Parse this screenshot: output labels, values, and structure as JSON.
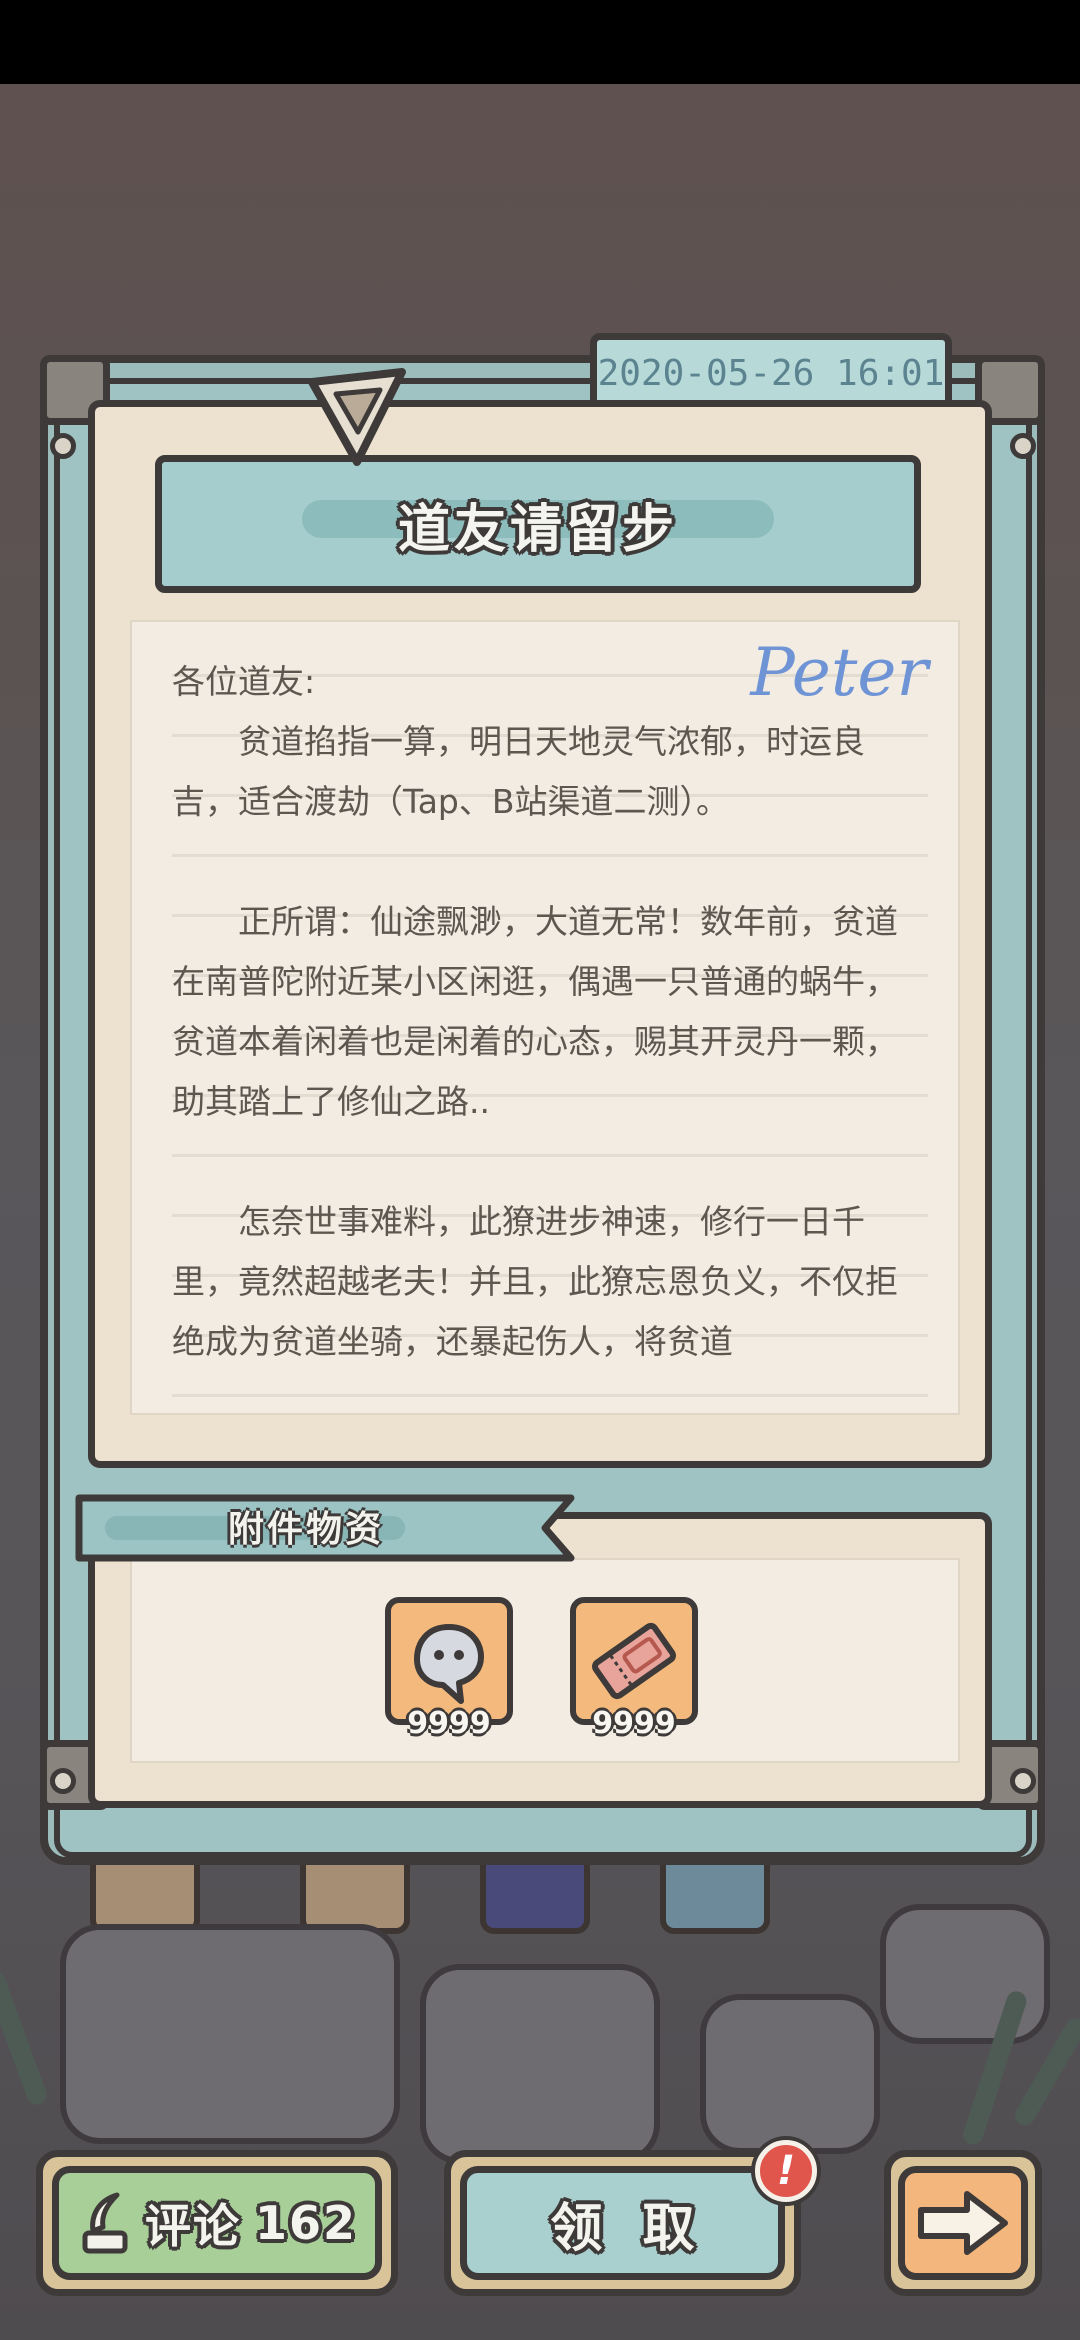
{
  "mail": {
    "date": "2020-05-26  16:01",
    "title": "道友请留步",
    "greeting": "各位道友:",
    "signature": "Peter",
    "paragraphs": [
      "贫道掐指一算，明日天地灵气浓郁，时运良吉，适合渡劫（Tap、B站渠道二测）。",
      "正所谓：仙途飘渺，大道无常！数年前，贫道在南普陀附近某小区闲逛，偶遇一只普通的蜗牛，贫道本着闲着也是闲着的心态，赐其开灵丹一颗，助其踏上了修仙之路..",
      "怎奈世事难料，此獠进步神速，修行一日千里，竟然超越老夫！并且，此獠忘恩负义，不仅拒绝成为贫道坐骑，还暴起伤人，将贫道"
    ]
  },
  "attachments": {
    "label": "附件物资",
    "items": [
      {
        "icon": "ghost-soul-icon",
        "count": "9999"
      },
      {
        "icon": "ticket-icon",
        "count": "9999"
      }
    ]
  },
  "buttons": {
    "comment_label": "评论",
    "comment_count": "162",
    "claim_label": "领取",
    "next_icon": "arrow-right-icon",
    "badge": "!"
  },
  "colors": {
    "frame": "#9fc3c3",
    "paper": "#ede2cf",
    "outline": "#3d3a39",
    "comment_green": "#a7cf97",
    "item_orange": "#f4b97c",
    "badge_red": "#e0564d"
  }
}
